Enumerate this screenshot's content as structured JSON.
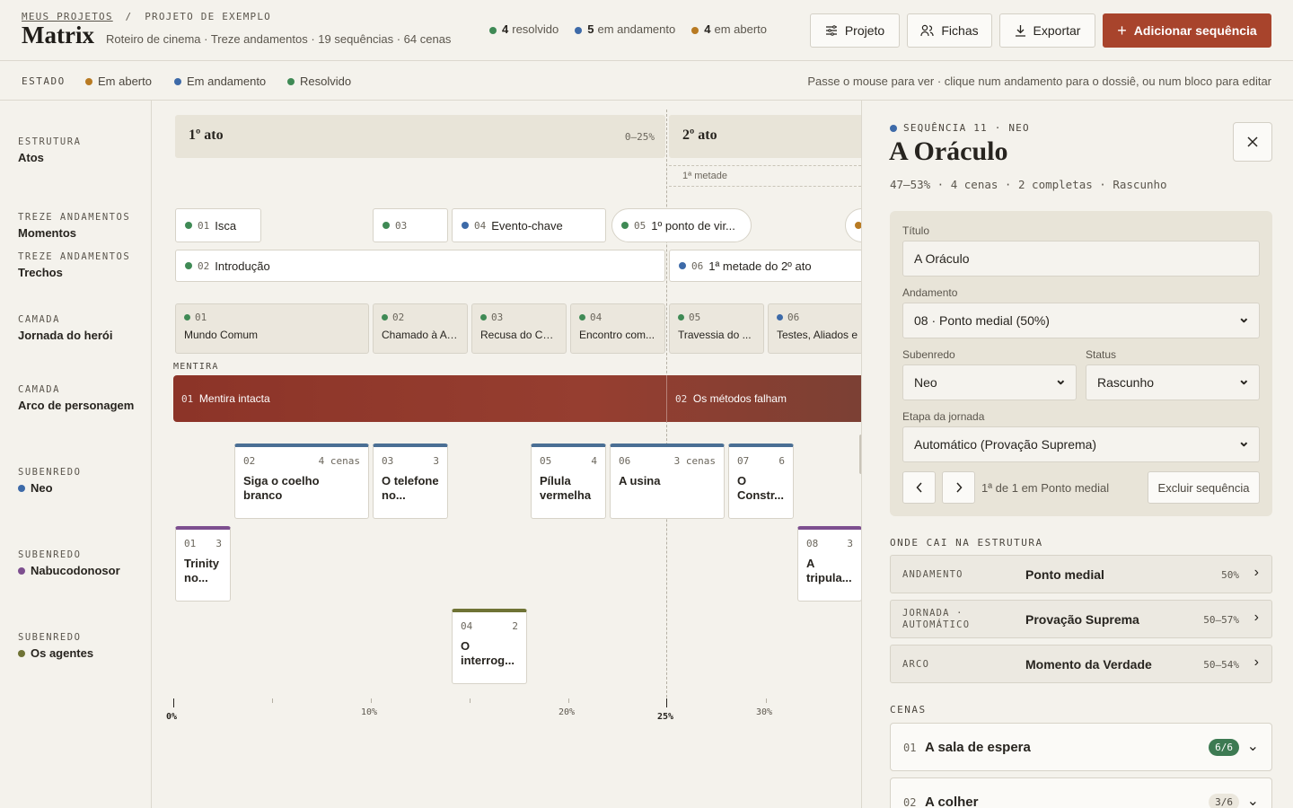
{
  "header": {
    "crumb_link": "MEUS PROJETOS",
    "crumb_sep": "/",
    "crumb_current": "PROJETO DE EXEMPLO",
    "title": "Matrix",
    "subtitle": "Roteiro de cinema · Treze andamentos · 19 sequências · 64 cenas",
    "stats": [
      {
        "count": "4",
        "label": "resolvido",
        "color": "#3f8a55"
      },
      {
        "count": "5",
        "label": "em andamento",
        "color": "#3d6aa8"
      },
      {
        "count": "4",
        "label": "em aberto",
        "color": "#b87a22"
      }
    ],
    "buttons": {
      "project": "Projeto",
      "cards": "Fichas",
      "export": "Exportar",
      "add": "Adicionar sequência"
    }
  },
  "statusbar": {
    "label": "ESTADO",
    "legend": [
      {
        "label": "Em aberto",
        "color": "#b87a22"
      },
      {
        "label": "Em andamento",
        "color": "#3d6aa8"
      },
      {
        "label": "Resolvido",
        "color": "#3f8a55"
      }
    ],
    "hint": "Passe o mouse para ver · clique num andamento para o dossiê, ou num bloco para editar"
  },
  "rows": [
    {
      "kind": "ESTRUTURA",
      "name": "Atos"
    },
    {
      "kind": "TREZE ANDAMENTOS",
      "name": "Momentos"
    },
    {
      "kind": "TREZE ANDAMENTOS",
      "name": "Trechos"
    },
    {
      "kind": "CAMADA",
      "name": "Jornada do herói"
    },
    {
      "kind": "CAMADA",
      "name": "Arco de personagem"
    },
    {
      "kind": "SUBENREDO",
      "name": "Neo",
      "color": "#3d6aa8"
    },
    {
      "kind": "SUBENREDO",
      "name": "Nabucodonosor",
      "color": "#7d4f8f"
    },
    {
      "kind": "SUBENREDO",
      "name": "Os agentes",
      "color": "#6f7335"
    }
  ],
  "timeline": {
    "acts": [
      {
        "label": "1º ato",
        "range": "0–25%"
      },
      {
        "label": "2º ato",
        "range": ""
      }
    ],
    "half_label": "1ª metade",
    "moments": [
      {
        "num": "01",
        "label": "Isca",
        "color": "#3f8a55"
      },
      {
        "num": "03",
        "label": "",
        "color": "#3f8a55"
      },
      {
        "num": "04",
        "label": "Evento-chave",
        "color": "#3d6aa8"
      },
      {
        "num": "05",
        "label": "1º ponto de vir...",
        "color": "#3f8a55"
      },
      {
        "num": "",
        "label": "",
        "color": "#b87a22"
      }
    ],
    "stretches": [
      {
        "num": "02",
        "label": "Introdução",
        "color": "#3f8a55"
      },
      {
        "num": "06",
        "label": "1ª metade do 2º ato",
        "color": "#3d6aa8"
      }
    ],
    "journey": [
      {
        "num": "01",
        "label": "Mundo Comum",
        "color": "#3f8a55"
      },
      {
        "num": "02",
        "label": "Chamado à Av...",
        "color": "#3f8a55"
      },
      {
        "num": "03",
        "label": "Recusa do Ch...",
        "color": "#3f8a55"
      },
      {
        "num": "04",
        "label": "Encontro com...",
        "color": "#3f8a55"
      },
      {
        "num": "05",
        "label": "Travessia do ...",
        "color": "#3f8a55"
      },
      {
        "num": "06",
        "label": "Testes, Aliados e",
        "color": "#3d6aa8"
      }
    ],
    "lie_label": "MENTIRA",
    "arc": [
      {
        "num": "01",
        "label": "Mentira intacta"
      },
      {
        "num": "02",
        "label": "Os métodos falham"
      }
    ],
    "neo_cards": [
      {
        "num": "02",
        "count": "4 cenas",
        "title": "Siga o coelho branco"
      },
      {
        "num": "03",
        "count": "3",
        "title": "O telefone no..."
      },
      {
        "num": "05",
        "count": "4",
        "title": "Pílula vermelha"
      },
      {
        "num": "06",
        "count": "3 cenas",
        "title": "A usina"
      },
      {
        "num": "07",
        "count": "6",
        "title": "O Constr..."
      }
    ],
    "neb_cards": [
      {
        "num": "01",
        "count": "3",
        "title": "Trinity no..."
      },
      {
        "num": "08",
        "count": "3",
        "title": "A tripula..."
      }
    ],
    "agent_cards": [
      {
        "num": "04",
        "count": "2",
        "title": "O interrog..."
      }
    ],
    "axis": [
      "0%",
      "10%",
      "20%",
      "25%",
      "30%"
    ]
  },
  "panel": {
    "seq_label": "SEQUÊNCIA 11 · NEO",
    "title": "A Oráculo",
    "meta": "47–53% · 4 cenas · 2 completas · Rascunho",
    "form": {
      "title_label": "Título",
      "title_value": "A Oráculo",
      "beat_label": "Andamento",
      "beat_value": "08 · Ponto medial (50%)",
      "subplot_label": "Subenredo",
      "subplot_value": "Neo",
      "status_label": "Status",
      "status_value": "Rascunho",
      "journey_label": "Etapa da jornada",
      "journey_value": "Automático (Provação Suprema)",
      "position_text": "1ª de 1 em Ponto medial",
      "delete_label": "Excluir sequência"
    },
    "structure_heading": "ONDE CAI NA ESTRUTURA",
    "structure": [
      {
        "kind": "ANDAMENTO",
        "kind2": "",
        "value": "Ponto medial",
        "pct": "50%"
      },
      {
        "kind": "JORNADA ·",
        "kind2": "AUTOMÁTICO",
        "value": "Provação Suprema",
        "pct": "50–57%"
      },
      {
        "kind": "ARCO",
        "kind2": "",
        "value": "Momento da Verdade",
        "pct": "50–54%"
      }
    ],
    "scenes_heading": "CENAS",
    "scenes": [
      {
        "num": "01",
        "title": "A sala de espera",
        "badge": "6/6"
      },
      {
        "num": "02",
        "title": "A colher",
        "badge": "3/6"
      }
    ]
  }
}
